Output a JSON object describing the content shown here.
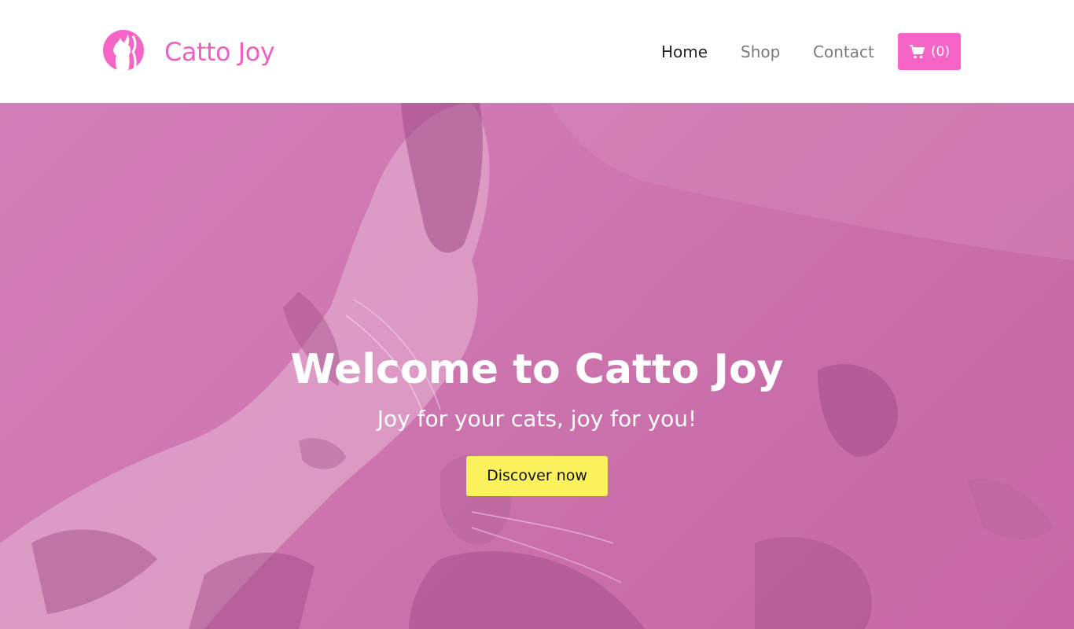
{
  "brand": {
    "name": "Catto Joy",
    "logo_icon": "cat-silhouette-icon",
    "color": "#f05fc2"
  },
  "nav": {
    "items": [
      {
        "label": "Home",
        "active": true
      },
      {
        "label": "Shop",
        "active": false
      },
      {
        "label": "Contact",
        "active": false
      }
    ],
    "cart": {
      "icon": "cart-icon",
      "count_label": "(0)",
      "color": "#f564c6"
    }
  },
  "hero": {
    "title": "Welcome to Catto Joy",
    "subtitle": "Joy for your cats, joy for you!",
    "cta_label": "Discover now",
    "cta_color": "#fcf25e",
    "overlay_color": "#cf78b2",
    "background_image": "playful-cat-photo"
  }
}
